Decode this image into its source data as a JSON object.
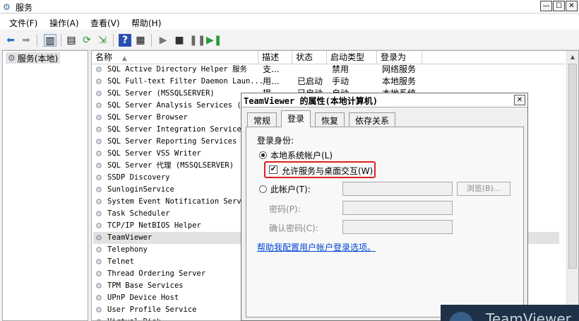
{
  "window": {
    "title": "服务"
  },
  "menu": [
    "文件(F)",
    "操作(A)",
    "查看(V)",
    "帮助(H)"
  ],
  "tree": {
    "root_label": "服务(本地)"
  },
  "list": {
    "columns": [
      "名称",
      "描述",
      "状态",
      "启动类型",
      "登录为"
    ],
    "rows": [
      {
        "name": "SQL Active Directory Helper 服务",
        "desc": "支...",
        "status": "",
        "startup": "禁用",
        "logon": "网络服务"
      },
      {
        "name": "SQL Full-text Filter Daemon Laun...",
        "desc": "用...",
        "status": "已启动",
        "startup": "手动",
        "logon": "本地服务"
      },
      {
        "name": "SQL Server (MSSQLSERVER)",
        "desc": "提...",
        "status": "已启动",
        "startup": "自动",
        "logon": "本地系统"
      },
      {
        "name": "SQL Server Analysis Services (MS",
        "desc": "",
        "status": "",
        "startup": "",
        "logon": ""
      },
      {
        "name": "SQL Server Browser",
        "desc": "",
        "status": "",
        "startup": "",
        "logon": ""
      },
      {
        "name": "SQL Server Integration Services",
        "desc": "",
        "status": "",
        "startup": "",
        "logon": ""
      },
      {
        "name": "SQL Server Reporting Services (M",
        "desc": "",
        "status": "",
        "startup": "",
        "logon": ""
      },
      {
        "name": "SQL Server VSS Writer",
        "desc": "",
        "status": "",
        "startup": "",
        "logon": ""
      },
      {
        "name": "SQL Server 代理 (MSSQLSERVER)",
        "desc": "",
        "status": "",
        "startup": "",
        "logon": ""
      },
      {
        "name": "SSDP Discovery",
        "desc": "",
        "status": "",
        "startup": "",
        "logon": ""
      },
      {
        "name": "SunloginService",
        "desc": "",
        "status": "",
        "startup": "",
        "logon": ""
      },
      {
        "name": "System Event Notification Servic",
        "desc": "",
        "status": "",
        "startup": "",
        "logon": ""
      },
      {
        "name": "Task Scheduler",
        "desc": "",
        "status": "",
        "startup": "",
        "logon": ""
      },
      {
        "name": "TCP/IP NetBIOS Helper",
        "desc": "",
        "status": "",
        "startup": "",
        "logon": ""
      },
      {
        "name": "TeamViewer",
        "desc": "",
        "status": "",
        "startup": "",
        "logon": "",
        "selected": true
      },
      {
        "name": "Telephony",
        "desc": "",
        "status": "",
        "startup": "",
        "logon": ""
      },
      {
        "name": "Telnet",
        "desc": "",
        "status": "",
        "startup": "",
        "logon": ""
      },
      {
        "name": "Thread Ordering Server",
        "desc": "",
        "status": "",
        "startup": "",
        "logon": ""
      },
      {
        "name": "TPM Base Services",
        "desc": "",
        "status": "",
        "startup": "",
        "logon": ""
      },
      {
        "name": "UPnP Device Host",
        "desc": "",
        "status": "",
        "startup": "",
        "logon": ""
      },
      {
        "name": "User Profile Service",
        "desc": "",
        "status": "",
        "startup": "",
        "logon": ""
      },
      {
        "name": "Virtual Disk",
        "desc": "",
        "status": "",
        "startup": "",
        "logon": ""
      }
    ]
  },
  "dialog": {
    "title": "TeamViewer 的属性(本地计算机)",
    "tabs": [
      "常规",
      "登录",
      "恢复",
      "依存关系"
    ],
    "active_tab": "登录",
    "logon_as_label": "登录身份:",
    "local_system_label": "本地系统帐户(L)",
    "interact_label": "允许服务与桌面交互(W)",
    "this_account_label": "此帐户(T):",
    "password_label": "密码(P):",
    "confirm_label": "确认密码(C):",
    "browse_label": "浏览(B)...",
    "help_link": "帮助我配置用户帐户登录选项。",
    "local_system_selected": true,
    "interact_checked": true
  },
  "overlay": {
    "brand": "TeamViewer"
  },
  "colors": {
    "highlight_box": "#e02020",
    "link": "#0046d5",
    "selection": "#e2e2e2"
  }
}
